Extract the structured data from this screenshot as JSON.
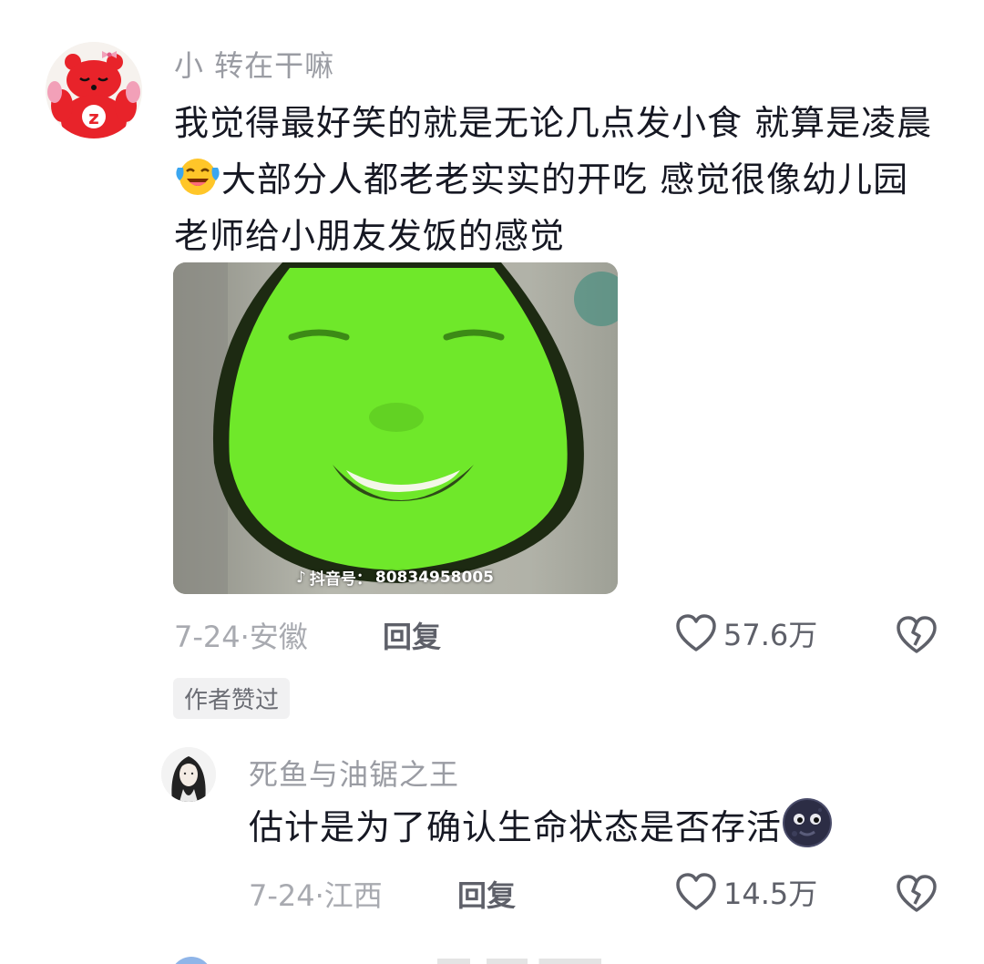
{
  "colors": {
    "text_primary": "#161823",
    "text_secondary": "#9a9ca3",
    "action": "#5e6069",
    "sticker_green": "#6fe82a",
    "badge_bg": "#f1f1f2"
  },
  "comment": {
    "avatar_icon": "red-bear-sleeping-avatar",
    "username": "小 转在干嘛",
    "text_part1": "我觉得最好笑的就是无论几点发小食 就算是凌晨",
    "inline_emoji": "laughing-crying-emoji",
    "text_part2": "大部分人都老老实实的开吃 感觉很像幼儿园老师给小朋友发饭的感觉",
    "sticker_watermark": "抖音号：",
    "sticker_watermark_id": "80834958005",
    "meta": "7-24·安徽",
    "reply_label": "回复",
    "likes": "57.6万",
    "author_liked_badge": "作者赞过"
  },
  "reply": {
    "avatar_icon": "long-hair-character-avatar",
    "username": "死鱼与油锯之王",
    "text": "估计是为了确认生命状态是否存活",
    "inline_emoji": "dark-moon-face-emoji",
    "meta": "7-24·江西",
    "reply_label": "回复",
    "likes": "14.5万"
  }
}
